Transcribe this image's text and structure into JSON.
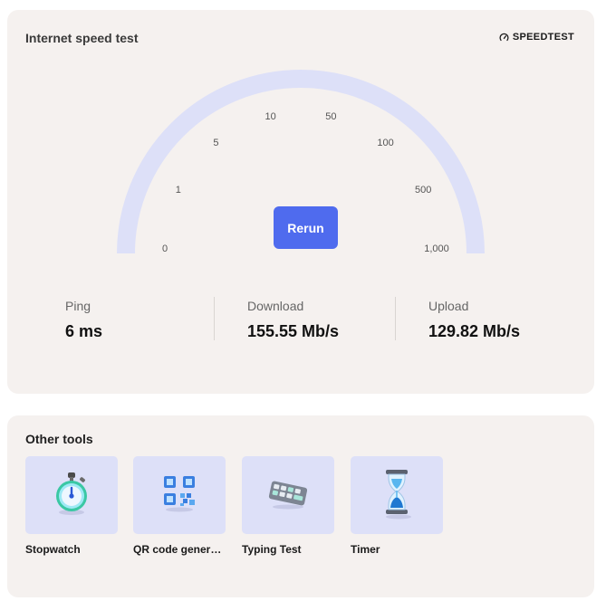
{
  "speedtest": {
    "title": "Internet speed test",
    "brand": "SPEEDTEST",
    "gauge": {
      "ticks": [
        "0",
        "1",
        "5",
        "10",
        "50",
        "100",
        "500",
        "1,000"
      ],
      "arc_color": "#dde0f8"
    },
    "rerun_label": "Rerun",
    "accent_color": "#4f6bee",
    "metrics": {
      "ping": {
        "label": "Ping",
        "value": "6 ms"
      },
      "download": {
        "label": "Download",
        "value": "155.55 Mb/s"
      },
      "upload": {
        "label": "Upload",
        "value": "129.82 Mb/s"
      }
    }
  },
  "tools": {
    "title": "Other tools",
    "items": [
      {
        "label": "Stopwatch",
        "icon": "stopwatch-icon"
      },
      {
        "label": "QR code generator",
        "icon": "qr-code-icon"
      },
      {
        "label": "Typing Test",
        "icon": "keyboard-icon"
      },
      {
        "label": "Timer",
        "icon": "hourglass-icon"
      }
    ]
  }
}
